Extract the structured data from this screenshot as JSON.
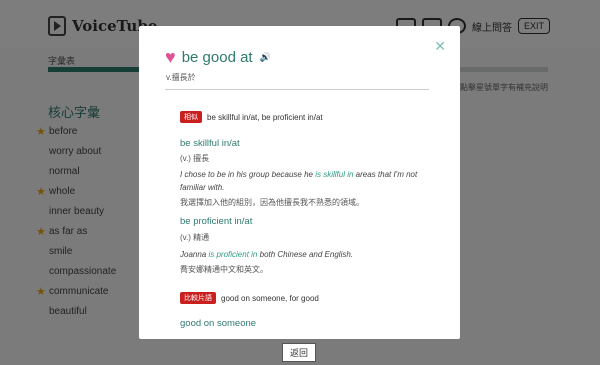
{
  "header": {
    "logo_text": "VoiceTube",
    "online_qa": "線上問答",
    "exit": "EXIT"
  },
  "vocab": {
    "label": "字彙表",
    "progress": 0.82,
    "hint": "點擊星號單字有補充說明"
  },
  "word_list": {
    "title": "核心字彙",
    "items": [
      {
        "word": "before",
        "starred": true
      },
      {
        "word": "worry about",
        "starred": false
      },
      {
        "word": "normal",
        "starred": false
      },
      {
        "word": "whole",
        "starred": true
      },
      {
        "word": "inner beauty",
        "starred": false
      },
      {
        "word": "as far as",
        "starred": true
      },
      {
        "word": "smile",
        "starred": false
      },
      {
        "word": "compassionate",
        "starred": false
      },
      {
        "word": "communicate",
        "starred": true
      },
      {
        "word": "beautiful",
        "starred": false
      }
    ]
  },
  "return_label": "返回",
  "modal": {
    "close": "✕",
    "heart": "♥",
    "headword": "be good at",
    "speaker": "🔊",
    "pos": "v.擅長於",
    "similar_tag": "相似",
    "similar_text": "be skillful in/at, be proficient in/at",
    "entries": [
      {
        "word": "be skillful in/at",
        "pos": "(v.) 擅長",
        "ex_before": "I chose to be in his group because he ",
        "ex_hl": "is skillful in",
        "ex_after": " areas that I'm not familiar with.",
        "zh": "我選擇加入他的組別，因為他擅長我不熟悉的領域。"
      },
      {
        "word": "be proficient in/at",
        "pos": "(v.) 精通",
        "ex_before": "Joanna ",
        "ex_hl": "is proficient in",
        "ex_after": " both Chinese and English.",
        "zh": "喬安娜精通中文和英文。"
      }
    ],
    "compare_tag": "比較片語",
    "compare_text": "good on someone, for good",
    "sub_word": "good on someone"
  }
}
